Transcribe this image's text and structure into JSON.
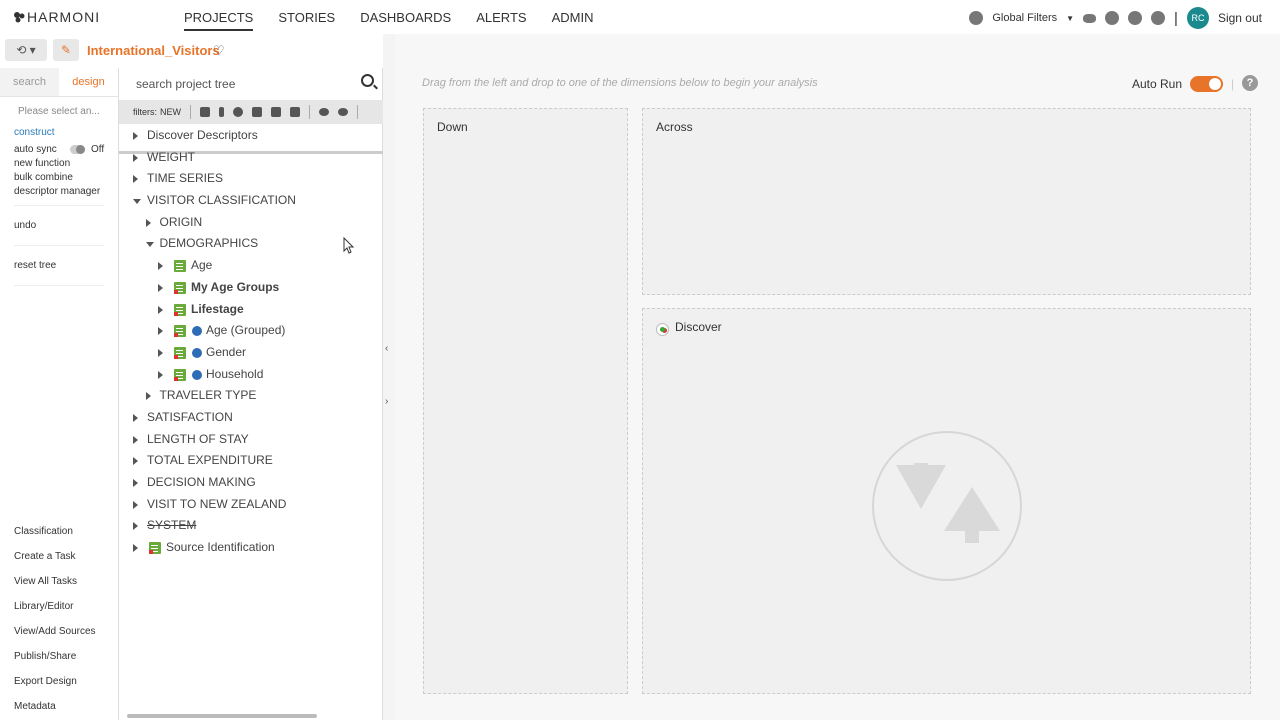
{
  "app": {
    "logo": "HARMONI"
  },
  "nav": {
    "items": [
      "PROJECTS",
      "STORIES",
      "DASHBOARDS",
      "ALERTS",
      "ADMIN"
    ],
    "active": "PROJECTS"
  },
  "topright": {
    "global_filters": "Global Filters",
    "avatar_initials": "RC",
    "sign_out": "Sign out"
  },
  "project": {
    "name": "International_Visitors"
  },
  "sidebar": {
    "tab_search": "search",
    "tab_design": "design",
    "select_placeholder": "Please select an...",
    "construct": "construct",
    "auto_sync": "auto sync",
    "auto_sync_state": "Off",
    "new_function": "new function",
    "bulk_combine": "bulk combine",
    "descriptor_manager": "descriptor manager",
    "undo": "undo",
    "reset_tree": "reset tree",
    "bottom_links": [
      "Classification",
      "Create a Task",
      "View All Tasks",
      "Library/Editor",
      "View/Add Sources",
      "Publish/Share",
      "Export Design",
      "Metadata"
    ]
  },
  "tree": {
    "search_placeholder": "search project tree",
    "filters_label": "filters:",
    "filters_new": "NEW",
    "nodes": [
      {
        "label": "Discover Descriptors",
        "level": 0,
        "expanded": false
      },
      {
        "label": "WEIGHT",
        "level": 0,
        "expanded": false
      },
      {
        "label": "TIME SERIES",
        "level": 0,
        "expanded": false
      },
      {
        "label": "VISITOR CLASSIFICATION",
        "level": 0,
        "expanded": true
      },
      {
        "label": "ORIGIN",
        "level": 1,
        "expanded": false
      },
      {
        "label": "DEMOGRAPHICS",
        "level": 1,
        "expanded": true
      },
      {
        "label": "Age",
        "level": 2,
        "icon": "variable-icon"
      },
      {
        "label": "My Age Groups",
        "level": 2,
        "icon": "variable-icon",
        "bold": true
      },
      {
        "label": "Lifestage",
        "level": 2,
        "icon": "variable-icon",
        "bold": true
      },
      {
        "label": "Age (Grouped)",
        "level": 2,
        "icon": "variable-icon",
        "info": true
      },
      {
        "label": "Gender",
        "level": 2,
        "icon": "variable-icon",
        "info": true
      },
      {
        "label": "Household",
        "level": 2,
        "icon": "variable-icon",
        "info": true
      },
      {
        "label": "TRAVELER TYPE",
        "level": 1,
        "expanded": false
      },
      {
        "label": "SATISFACTION",
        "level": 0,
        "expanded": false
      },
      {
        "label": "LENGTH OF STAY",
        "level": 0,
        "expanded": false
      },
      {
        "label": "TOTAL EXPENDITURE",
        "level": 0,
        "expanded": false
      },
      {
        "label": "DECISION MAKING",
        "level": 0,
        "expanded": false
      },
      {
        "label": "VISIT TO NEW ZEALAND",
        "level": 0,
        "expanded": false
      },
      {
        "label": "SYSTEM",
        "level": 0,
        "expanded": false,
        "strike": true
      },
      {
        "label": "Source Identification",
        "level": 0,
        "icon": "source-icon"
      }
    ]
  },
  "canvas": {
    "hint": "Drag from the left and drop to one of the dimensions below to begin your analysis",
    "auto_run": "Auto Run",
    "down": "Down",
    "across": "Across",
    "discover": "Discover"
  }
}
